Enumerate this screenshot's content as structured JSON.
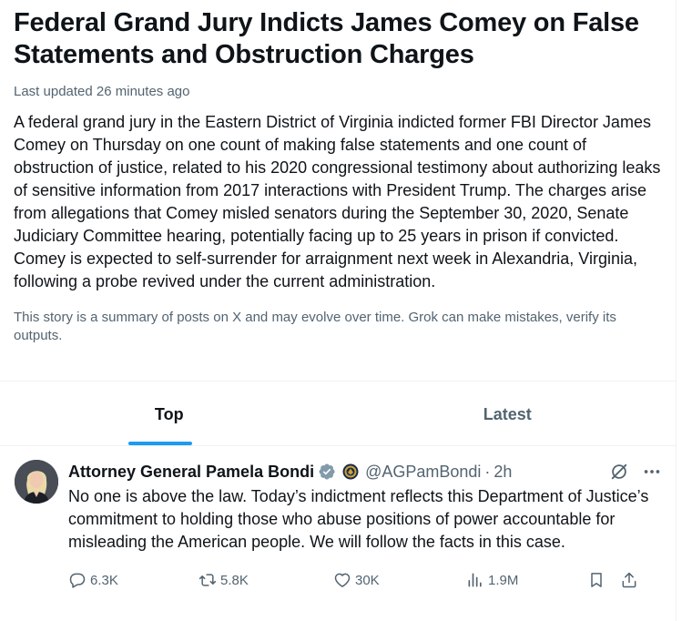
{
  "story": {
    "headline_line1": "Federal Grand Jury Indicts James Comey on False",
    "headline_line2": "Statements and Obstruction Charges",
    "updated": "Last updated 26 minutes ago",
    "summary": "A federal grand jury in the Eastern District of Virginia indicted former FBI Director James Comey on Thursday on one count of making false statements and one count of obstruction of justice, related to his 2020 congressional testimony about authorizing leaks of sensitive information from 2017 interactions with President Trump. The charges arise from allegations that Comey misled senators during the September 30, 2020, Senate Judiciary Committee hearing, potentially facing up to 25 years in prison if convicted. Comey is expected to self-surrender for arraignment next week in Alexandria, Virginia, following a probe revived under the current administration.",
    "disclaimer": "This story is a summary of posts on X and may evolve over time. Grok can make mistakes, verify its outputs."
  },
  "tabs": [
    {
      "label": "Top",
      "active": true
    },
    {
      "label": "Latest",
      "active": false
    }
  ],
  "post": {
    "author": "Attorney General Pamela Bondi",
    "handle": "@AGPamBondi",
    "separator": "·",
    "time": "2h",
    "text": "No one is above the law. Today’s indictment reflects this Department of Justice’s commitment to holding those who abuse positions of power accountable for misleading the American people. We will follow the facts in this case.",
    "replies": "6.3K",
    "reposts": "5.8K",
    "likes": "30K",
    "views": "1.9M",
    "icons": [
      "verified-badge-icon",
      "doj-seal-icon",
      "grok-icon",
      "more-icon",
      "reply-icon",
      "repost-icon",
      "like-icon",
      "views-icon",
      "bookmark-icon",
      "share-icon"
    ]
  },
  "colors": {
    "accent": "#1d9bf0",
    "text_primary": "#0f1419",
    "text_secondary": "#536471",
    "divider": "#eff3f4"
  }
}
